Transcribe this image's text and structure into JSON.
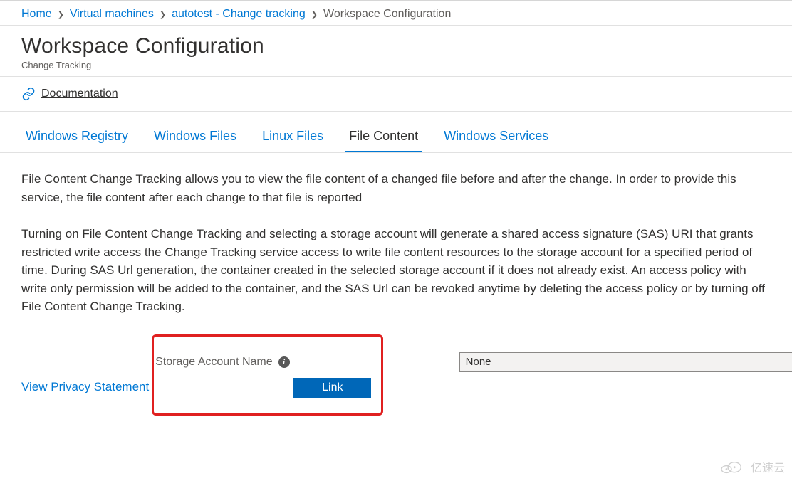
{
  "breadcrumb": {
    "items": [
      {
        "label": "Home"
      },
      {
        "label": "Virtual machines"
      },
      {
        "label": "autotest - Change tracking"
      }
    ],
    "current": "Workspace Configuration"
  },
  "header": {
    "title": "Workspace Configuration",
    "subtitle": "Change Tracking"
  },
  "documentation": {
    "label": "Documentation"
  },
  "tabs": {
    "items": [
      {
        "label": "Windows Registry"
      },
      {
        "label": "Windows Files"
      },
      {
        "label": "Linux Files"
      },
      {
        "label": "File Content"
      },
      {
        "label": "Windows Services"
      }
    ]
  },
  "body": {
    "para1": "File Content Change Tracking allows you to view the file content of a changed file before and after the change. In order to provide this service, the file content after each change to that file is reported",
    "para2": "Turning on File Content Change Tracking and selecting a storage account will generate a shared access signature (SAS) URI that grants restricted write access the Change Tracking service access to write file content resources to the storage account for a specified period of time. During SAS Url generation, the container created in the selected storage account if it does not already exist. An access policy with write only permission will be added to the container, and the SAS Url can be revoked anytime by deleting the access policy or by turning off File Content Change Tracking.",
    "privacy_link": "View Privacy Statement"
  },
  "storage": {
    "label": "Storage Account Name",
    "value": "None",
    "link_button": "Link"
  },
  "watermark": {
    "text": "亿速云"
  }
}
